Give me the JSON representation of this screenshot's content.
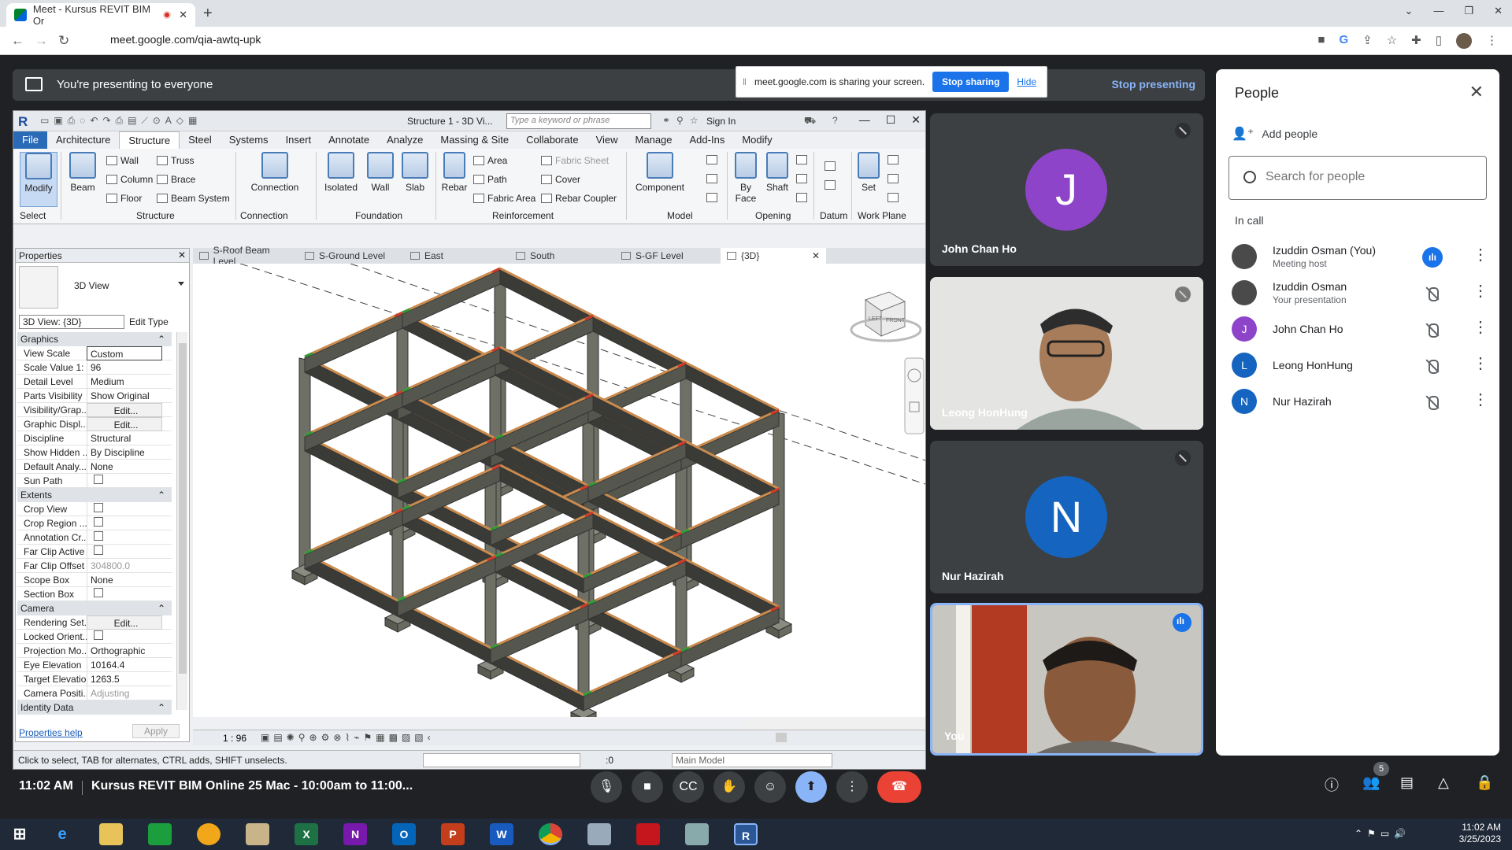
{
  "browser": {
    "tab_title": "Meet - Kursus REVIT BIM Or",
    "new_tab": "+",
    "url": "meet.google.com/qia-awtq-upk"
  },
  "present_bar": {
    "text": "You're presenting to everyone",
    "stop_presenting": "Stop presenting"
  },
  "share_notice": {
    "text": "meet.google.com is sharing your screen.",
    "stop_sharing": "Stop sharing",
    "hide": "Hide"
  },
  "revit": {
    "doc_title": "Structure 1 - 3D Vi...",
    "search_placeholder": "Type a keyword or phrase",
    "sign_in": "Sign In",
    "menu": [
      "File",
      "Architecture",
      "Structure",
      "Steel",
      "Systems",
      "Insert",
      "Annotate",
      "Analyze",
      "Massing & Site",
      "Collaborate",
      "View",
      "Manage",
      "Add-Ins",
      "Modify"
    ],
    "ribbon": {
      "modify": "Modify",
      "beam": "Beam",
      "wall": "Wall",
      "column": "Column",
      "floor": "Floor",
      "truss": "Truss",
      "brace": "Brace",
      "beam_system": "Beam  System",
      "connection": "Connection",
      "isolated": "Isolated",
      "wall_f": "Wall",
      "slab": "Slab",
      "rebar": "Rebar",
      "area": "Area",
      "path": "Path",
      "fabric_area": "Fabric  Area",
      "fabric_sheet": "Fabric  Sheet",
      "cover": "Cover",
      "rebar_coupler": "Rebar  Coupler",
      "component": "Component",
      "by_face": "By Face",
      "shaft": "Shaft",
      "set": "Set",
      "panels": {
        "select": "Select",
        "structure": "Structure",
        "connection": "Connection",
        "foundation": "Foundation",
        "reinforcement": "Reinforcement",
        "model": "Model",
        "opening": "Opening",
        "datum": "Datum",
        "work_plane": "Work Plane"
      }
    },
    "properties": {
      "title": "Properties",
      "type_name": "3D View",
      "selector": "3D View: {3D}",
      "edit_type": "Edit Type",
      "groups": {
        "graphics": "Graphics",
        "extents": "Extents",
        "camera": "Camera",
        "identity": "Identity Data"
      },
      "graphics_rows": [
        {
          "k": "View Scale",
          "v": "Custom"
        },
        {
          "k": "Scale Value   1:",
          "v": "96"
        },
        {
          "k": "Detail Level",
          "v": "Medium"
        },
        {
          "k": "Parts Visibility",
          "v": "Show Original"
        },
        {
          "k": "Visibility/Grap...",
          "v": "Edit..."
        },
        {
          "k": "Graphic Displ...",
          "v": "Edit..."
        },
        {
          "k": "Discipline",
          "v": "Structural"
        },
        {
          "k": "Show Hidden ...",
          "v": "By Discipline"
        },
        {
          "k": "Default Analy...",
          "v": "None"
        },
        {
          "k": "Sun Path",
          "v": ""
        }
      ],
      "extents_rows": [
        {
          "k": "Crop View",
          "v": ""
        },
        {
          "k": "Crop Region ...",
          "v": ""
        },
        {
          "k": "Annotation Cr...",
          "v": ""
        },
        {
          "k": "Far Clip Active",
          "v": ""
        },
        {
          "k": "Far Clip Offset",
          "v": "304800.0"
        },
        {
          "k": "Scope Box",
          "v": "None"
        },
        {
          "k": "Section Box",
          "v": ""
        }
      ],
      "camera_rows": [
        {
          "k": "Rendering Set...",
          "v": "Edit..."
        },
        {
          "k": "Locked Orient...",
          "v": ""
        },
        {
          "k": "Projection Mo...",
          "v": "Orthographic"
        },
        {
          "k": "Eye Elevation",
          "v": "10164.4"
        },
        {
          "k": "Target Elevation",
          "v": "1263.5"
        },
        {
          "k": "Camera Positi...",
          "v": "Adjusting"
        }
      ],
      "help": "Properties help",
      "apply": "Apply"
    },
    "view_tabs": [
      "S-Roof Beam Level",
      "S-Ground Level",
      "East",
      "South",
      "S-GF Level",
      "{3D}"
    ],
    "view_scale": "1 : 96",
    "status": "Click to select, TAB for alternates, CTRL adds, SHIFT unselects.",
    "status_zero": ":0",
    "model": "Main Model",
    "viewcube": {
      "left": "LEFT",
      "front": "FRONT"
    }
  },
  "tiles": [
    {
      "name": "John Chan Ho",
      "initial": "J",
      "color": "#8e44c9"
    },
    {
      "name": "Leong HonHung"
    },
    {
      "name": "Nur Hazirah",
      "initial": "N",
      "color": "#1565c0"
    },
    {
      "name": "You"
    }
  ],
  "people": {
    "title": "People",
    "add_people": "Add people",
    "search_placeholder": "Search for people",
    "in_call": "In call",
    "list": [
      {
        "name": "Izuddin Osman (You)",
        "sub": "Meeting host"
      },
      {
        "name": "Izuddin Osman",
        "sub": "Your presentation"
      },
      {
        "name": "John Chan Ho",
        "initial": "J",
        "color": "#8e44c9"
      },
      {
        "name": "Leong HonHung",
        "initial": "L",
        "color": "#1565c0"
      },
      {
        "name": "Nur Hazirah",
        "initial": "N",
        "color": "#1565c0"
      }
    ]
  },
  "meet_bar": {
    "time": "11:02 AM",
    "meeting": "Kursus REVIT BIM Online 25 Mac - 10:00am to 11:00...",
    "participant_count": "5"
  },
  "taskbar": {
    "time": "11:02 AM",
    "date": "3/25/2023",
    "apps": [
      "X",
      "N",
      "O",
      "P",
      "W",
      "R"
    ]
  }
}
